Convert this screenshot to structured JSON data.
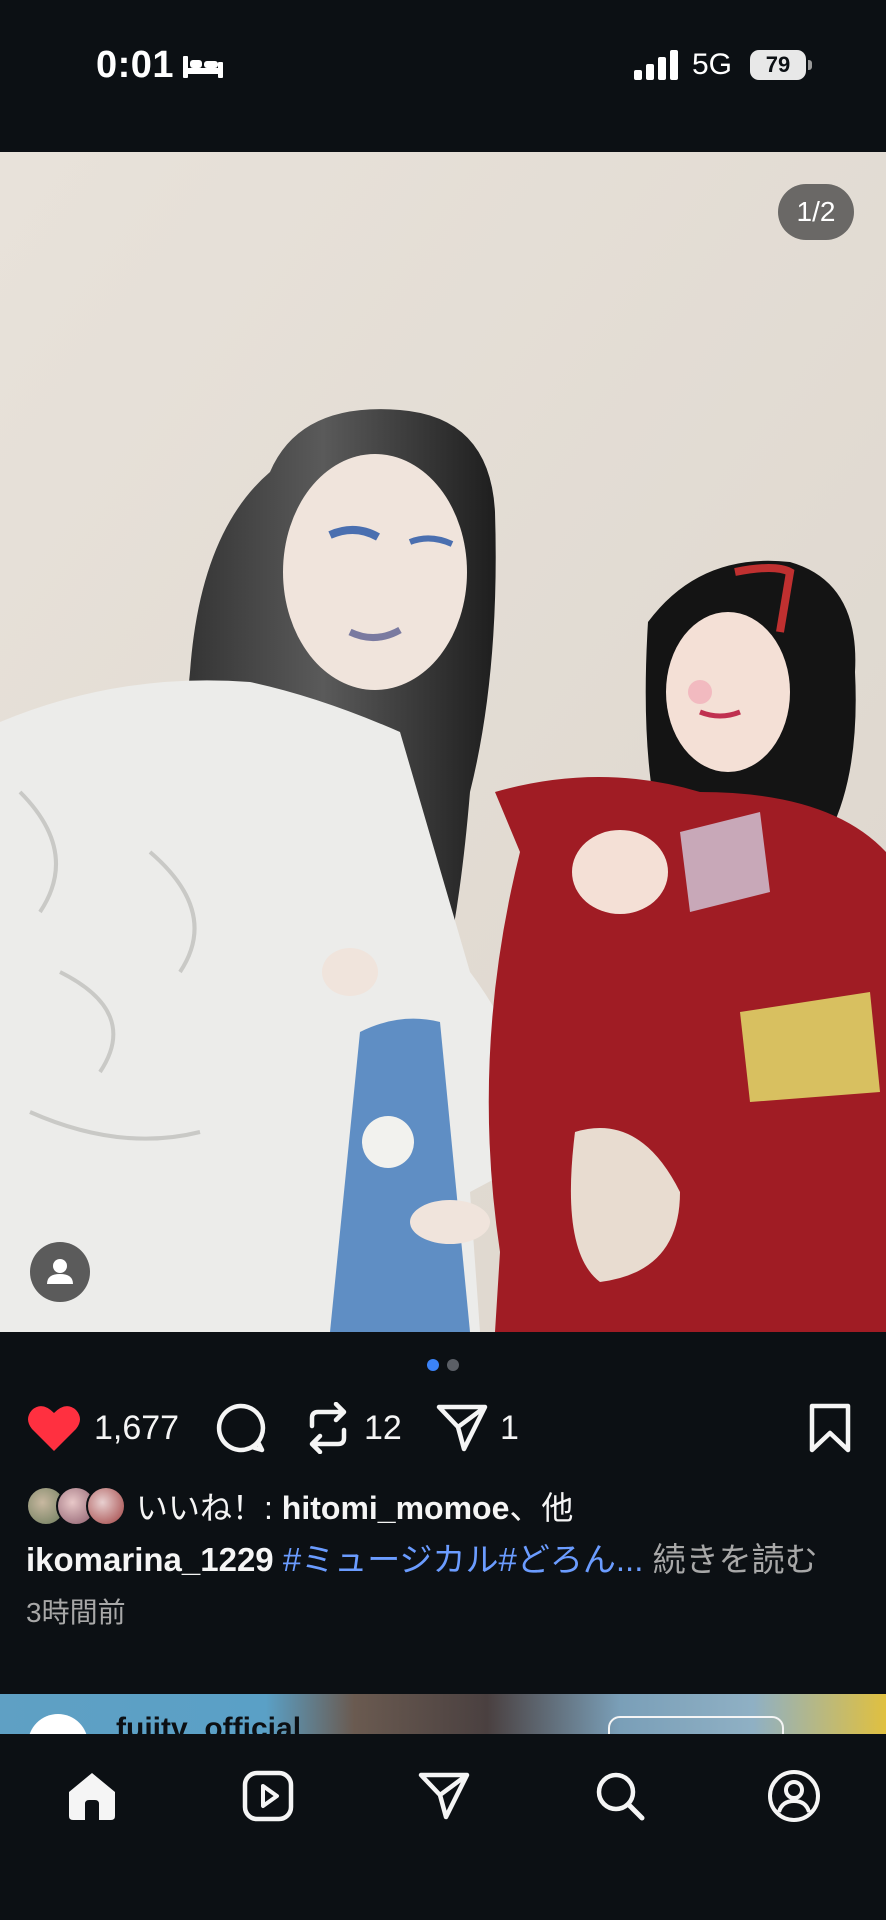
{
  "status_bar": {
    "time": "0:01",
    "network": "5G",
    "battery": "79",
    "icons": [
      "bed-icon",
      "signal-icon",
      "battery-icon"
    ]
  },
  "post": {
    "image_counter": "1/2",
    "carousel": {
      "count": 2,
      "active_index": 0
    },
    "actions": {
      "likes": "1,677",
      "reposts": "12",
      "shares": "1",
      "icons": [
        "heart-icon",
        "comment-icon",
        "repost-icon",
        "share-icon",
        "bookmark-icon"
      ]
    },
    "liked_by": {
      "prefix": "いいね！: ",
      "username": "hitomi_momoe",
      "suffix": "、他"
    },
    "caption": {
      "username": "ikomarina_1229",
      "hashtags": "#ミュージカル#どろん...",
      "more": "続きを読む"
    },
    "timestamp": "3時間前"
  },
  "next_post": {
    "username": "fujitv_official"
  },
  "nav": {
    "items": [
      "home-icon",
      "reels-icon",
      "messages-icon",
      "search-icon",
      "profile-icon"
    ]
  },
  "colors": {
    "background": "#0c1014",
    "accent_blue": "#3b82f6",
    "hashtag_blue": "#6b9cff",
    "like_red": "#ff3040",
    "muted_text": "#a8a8a8"
  }
}
